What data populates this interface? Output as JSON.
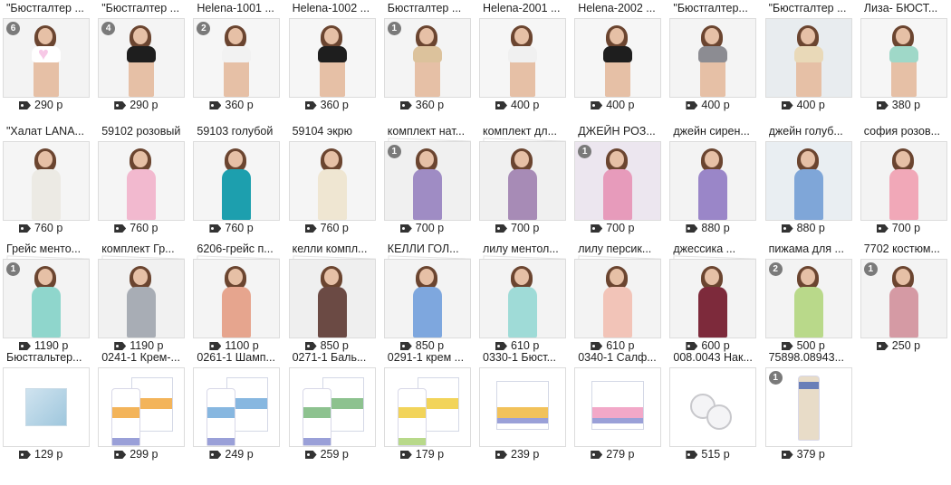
{
  "items": [
    {
      "title": "\"Бюстгалтер ...",
      "price": "290 р",
      "badge": "6",
      "colors": [
        "#f3f3f3",
        "#e6c0a6",
        "#ffffff",
        "#f7c8e6"
      ],
      "kind": "collage"
    },
    {
      "title": "\"Бюстгалтер ...",
      "price": "290 р",
      "badge": "4",
      "colors": [
        "#f4f4f4",
        "#e6c0a6",
        "#1e1e1e"
      ],
      "kind": "bra"
    },
    {
      "title": "Helena-1001 ...",
      "price": "360 р",
      "badge": "2",
      "colors": [
        "#f6f6f6",
        "#e6c0a6",
        "#f2f2f2"
      ],
      "kind": "bra"
    },
    {
      "title": "Helena-1002 ...",
      "price": "360 р",
      "badge": "",
      "colors": [
        "#f6f6f6",
        "#e6c0a6",
        "#1e1e1e"
      ],
      "kind": "bra"
    },
    {
      "title": "Бюстгалтер ...",
      "price": "360 р",
      "badge": "1",
      "colors": [
        "#f4f4f4",
        "#e6c0a6",
        "#dcc29c"
      ],
      "kind": "bra"
    },
    {
      "title": "Helena-2001 ...",
      "price": "400 р",
      "badge": "",
      "colors": [
        "#f6f6f6",
        "#e6c0a6",
        "#f0f0f0"
      ],
      "kind": "bra"
    },
    {
      "title": "Helena-2002 ...",
      "price": "400 р",
      "badge": "",
      "colors": [
        "#f6f6f6",
        "#e6c0a6",
        "#1e1e1e"
      ],
      "kind": "bra"
    },
    {
      "title": "\"Бюстгалтер...",
      "price": "400 р",
      "badge": "",
      "colors": [
        "#f4f4f4",
        "#e6c0a6",
        "#8c8c92"
      ],
      "kind": "bra"
    },
    {
      "title": "\"Бюстгалтер ...",
      "price": "400 р",
      "badge": "",
      "colors": [
        "#e8ecef",
        "#e6c0a6",
        "#e9d9b8"
      ],
      "kind": "bra"
    },
    {
      "title": "Лиза- БЮСТ...",
      "price": "380 р",
      "badge": "",
      "colors": [
        "#f6f6f6",
        "#e6c0a6",
        "#9fd8c8"
      ],
      "kind": "bra"
    },
    {
      "title": "\"Халат LANA...",
      "price": "760 р",
      "badge": "",
      "colors": [
        "#f5f5f5",
        "#e6c0a6",
        "#eceae4"
      ],
      "kind": "gown"
    },
    {
      "title": "59102 розовый",
      "price": "760 р",
      "badge": "",
      "colors": [
        "#f5f5f5",
        "#e6c0a6",
        "#f2b9cf"
      ],
      "kind": "gown"
    },
    {
      "title": "59103 голубой",
      "price": "760 р",
      "badge": "",
      "colors": [
        "#f5f5f5",
        "#e6c0a6",
        "#1d9fae"
      ],
      "kind": "gown"
    },
    {
      "title": "59104 экрю",
      "price": "760 р",
      "badge": "",
      "colors": [
        "#f5f5f5",
        "#e6c0a6",
        "#efe6d2"
      ],
      "kind": "gown"
    },
    {
      "title": "комплект нат...",
      "price": "700 р",
      "badge": "1",
      "colors": [
        "#f0f0f0",
        "#e6c0a6",
        "#9f8cc4"
      ],
      "kind": "gown",
      "stack": true
    },
    {
      "title": "комплект дл...",
      "price": "700 р",
      "badge": "",
      "colors": [
        "#f0f0f0",
        "#e6c0a6",
        "#a78bb6"
      ],
      "kind": "gown",
      "stack": true
    },
    {
      "title": "ДЖЕЙН РОЗ...",
      "price": "700 р",
      "badge": "1",
      "colors": [
        "#ece6ef",
        "#e6c0a6",
        "#e79bbb"
      ],
      "kind": "gown"
    },
    {
      "title": "джейн сирен...",
      "price": "880 р",
      "badge": "",
      "colors": [
        "#f3f3f3",
        "#e6c0a6",
        "#9a86c8"
      ],
      "kind": "gown"
    },
    {
      "title": "джейн голуб...",
      "price": "880 р",
      "badge": "",
      "colors": [
        "#e9eef2",
        "#e6c0a6",
        "#7fa6d8"
      ],
      "kind": "gown"
    },
    {
      "title": "софия розов...",
      "price": "700 р",
      "badge": "",
      "colors": [
        "#f3f3f3",
        "#e6c0a6",
        "#f1a8b8"
      ],
      "kind": "gown"
    },
    {
      "title": "Грейс менто...",
      "price": "1190 р",
      "badge": "1",
      "colors": [
        "#f3f3f3",
        "#e6c0a6",
        "#8fd6cc"
      ],
      "kind": "gown",
      "stack": true
    },
    {
      "title": "комплект Гр...",
      "price": "1190 р",
      "badge": "",
      "colors": [
        "#f1f1f1",
        "#e6c0a6",
        "#a8adb5"
      ],
      "kind": "gown",
      "stack": true
    },
    {
      "title": "6206-грейс п...",
      "price": "1100 р",
      "badge": "",
      "colors": [
        "#f4f4f4",
        "#e6c0a6",
        "#e6a58e"
      ],
      "kind": "gown",
      "stack": true
    },
    {
      "title": "келли компл...",
      "price": "850 р",
      "badge": "",
      "colors": [
        "#efefef",
        "#e6c0a6",
        "#6b4a44"
      ],
      "kind": "gown",
      "stack": true
    },
    {
      "title": "КЕЛЛИ ГОЛ...",
      "price": "850 р",
      "badge": "",
      "colors": [
        "#f3f3f3",
        "#e6c0a6",
        "#7ea7de"
      ],
      "kind": "gown",
      "stack": true
    },
    {
      "title": "лилу ментол...",
      "price": "610 р",
      "badge": "",
      "colors": [
        "#f3f3f3",
        "#e6c0a6",
        "#9fdbd7"
      ],
      "kind": "gown",
      "stack": true
    },
    {
      "title": "лилу персик...",
      "price": "610 р",
      "badge": "",
      "colors": [
        "#f3f3f3",
        "#e6c0a6",
        "#f2c4b8"
      ],
      "kind": "gown",
      "stack": true
    },
    {
      "title": "джессика ...",
      "price": "600 р",
      "badge": "",
      "colors": [
        "#f3f3f3",
        "#e6c0a6",
        "#7d2a3b"
      ],
      "kind": "gown",
      "stack": true
    },
    {
      "title": "пижама для ...",
      "price": "500 р",
      "badge": "2",
      "colors": [
        "#f3f3f3",
        "#e6c0a6",
        "#b9d98a"
      ],
      "kind": "gown"
    },
    {
      "title": "7702 костюм...",
      "price": "250 р",
      "badge": "1",
      "colors": [
        "#f3f3f3",
        "#e6c0a6",
        "#d59aa4"
      ],
      "kind": "gown"
    },
    {
      "title": "Бюстгальтер...",
      "price": "129 р",
      "badge": "",
      "colors": [
        "#ffffff",
        "#cfe3ef",
        "#9fc7dd"
      ],
      "kind": "cube"
    },
    {
      "title": "0241-1 Крем-...",
      "price": "299 р",
      "badge": "",
      "colors": [
        "#ffffff",
        "#f3b45a",
        "#9aa0d8"
      ],
      "kind": "tubebox"
    },
    {
      "title": "0261-1 Шамп...",
      "price": "249 р",
      "badge": "",
      "colors": [
        "#ffffff",
        "#87b7e0",
        "#9aa0d8"
      ],
      "kind": "tubebox"
    },
    {
      "title": "0271-1 Баль...",
      "price": "259 р",
      "badge": "",
      "colors": [
        "#ffffff",
        "#8dc28f",
        "#9aa0d8"
      ],
      "kind": "tubebox"
    },
    {
      "title": "0291-1 крем ...",
      "price": "179 р",
      "badge": "",
      "colors": [
        "#ffffff",
        "#f2d45a",
        "#b8d98a"
      ],
      "kind": "tubebox"
    },
    {
      "title": "0330-1 Бюст...",
      "price": "239 р",
      "badge": "",
      "colors": [
        "#ffffff",
        "#f2c25a",
        "#9aa0d8"
      ],
      "kind": "box"
    },
    {
      "title": "0340-1 Салф...",
      "price": "279 р",
      "badge": "",
      "colors": [
        "#ffffff",
        "#f2a8c8",
        "#9aa0d8"
      ],
      "kind": "box"
    },
    {
      "title": "008.0043 Нак...",
      "price": "515 р",
      "badge": "",
      "colors": [
        "#ffffff",
        "#d8d8dc",
        "#c8c8cc"
      ],
      "kind": "pads"
    },
    {
      "title": "75898.08943...",
      "price": "379 р",
      "badge": "1",
      "colors": [
        "#ffffff",
        "#e8dcc8",
        "#6a7fb8"
      ],
      "kind": "tubeonly"
    }
  ]
}
